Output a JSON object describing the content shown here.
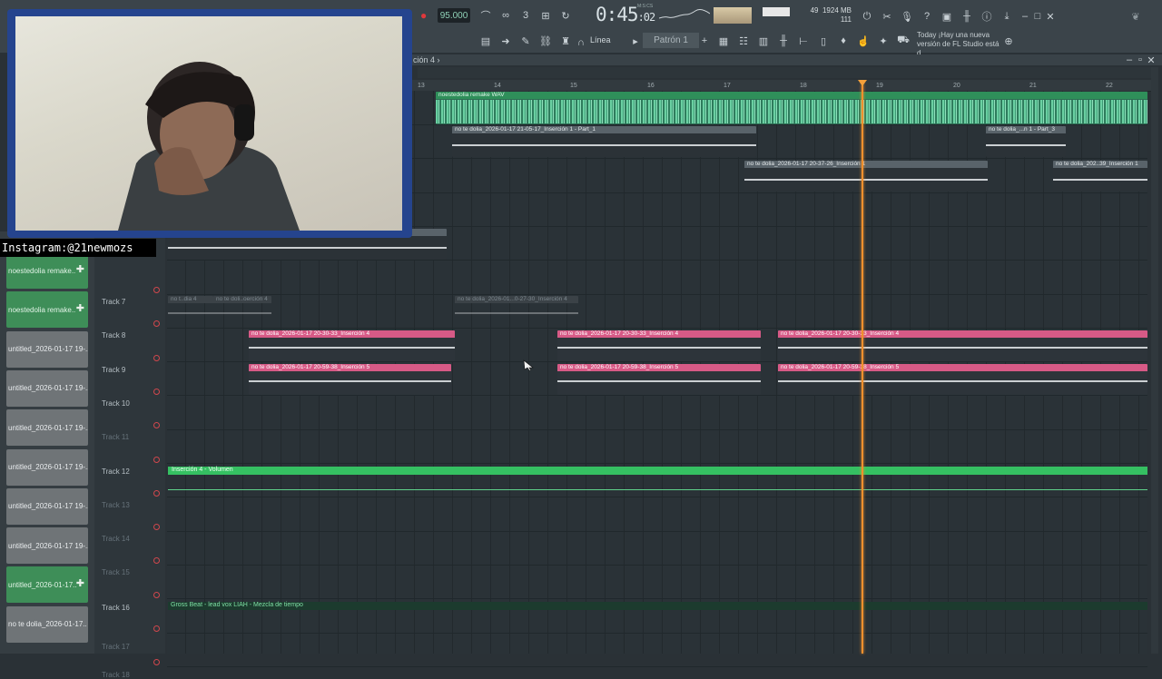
{
  "toolbar": {
    "bpm": "95.000",
    "time_main": "0:45",
    "time_frac": ":02",
    "time_unit": "M:S:CS",
    "cpu_val": "49",
    "mem_val": "1924 MB",
    "poly_val": "111",
    "snap_mode": "Línea",
    "pattern": "Patrón 1",
    "news_day": "Today",
    "news_text": "¡Hay una nueva versión de FL Studio está d.."
  },
  "playlist": {
    "title": "ción 4",
    "ruler": [
      "13",
      "14",
      "15",
      "16",
      "17",
      "18",
      "19",
      "20",
      "21",
      "22"
    ]
  },
  "overlay": {
    "instagram": "Instagram:@21newmozs"
  },
  "browser": {
    "items": [
      {
        "label": "noestedolia remake..",
        "green": true
      },
      {
        "label": "noestedolia remake..",
        "green": true
      },
      {
        "label": "untitled_2026-01-17 19-..",
        "green": false
      },
      {
        "label": "untitled_2026-01-17 19-..",
        "green": false
      },
      {
        "label": "untitled_2026-01-17 19-..",
        "green": false
      },
      {
        "label": "untitled_2026-01-17 19-..",
        "green": false
      },
      {
        "label": "untitled_2026-01-17 19-..",
        "green": false
      },
      {
        "label": "untitled_2026-01-17 19-..",
        "green": false
      },
      {
        "label": "untitled_2026-01-17..",
        "green": true
      },
      {
        "label": "no te dolia_2026-01-17..",
        "green": false
      }
    ]
  },
  "tracks": [
    {
      "name": "Track 7",
      "dim": false
    },
    {
      "name": "Track 8",
      "dim": false
    },
    {
      "name": "Track 9",
      "dim": false
    },
    {
      "name": "Track 10",
      "dim": false
    },
    {
      "name": "Track 11",
      "dim": true
    },
    {
      "name": "Track 12",
      "dim": false
    },
    {
      "name": "Track 13",
      "dim": true
    },
    {
      "name": "Track 14",
      "dim": true
    },
    {
      "name": "Track 15",
      "dim": true
    },
    {
      "name": "Track 16",
      "dim": false
    },
    {
      "name": "Track 17",
      "dim": true
    },
    {
      "name": "Track 18",
      "dim": true
    }
  ],
  "clips": {
    "audio_wav": "noestedolia remake WAV",
    "part1": "no te dolia_2026-01-17 21-05-17_Inserción 1 - Part_1",
    "part3": "no te dolia_...n 1 - Part_3",
    "ins1a": "no te dolia_2026-01-17 20-37-26_Inserción 1",
    "ins1b": "no te dolia_202..39_Inserción 1",
    "t7a": "no t..dia 4",
    "t7b": "no te doli..oerción 4",
    "t7c": "no te dolia_2026-01...0-27-30_Inserción 4",
    "ins4": "no te dolia_2026-01-17 20-30-33_Inserción 4",
    "ins5": "no te dolia_2026-01-17 20-59-38_Inserción 5",
    "automation": "Inserción 4 - Volumen",
    "gross": "Gross Beat - lead vox LIAH - Mezcla de tiempo"
  },
  "colors": {
    "accent_orange": "#f0902d",
    "clip_pink": "#d75a86",
    "clip_green": "#2f8f5a",
    "automation_green": "#35c062"
  }
}
